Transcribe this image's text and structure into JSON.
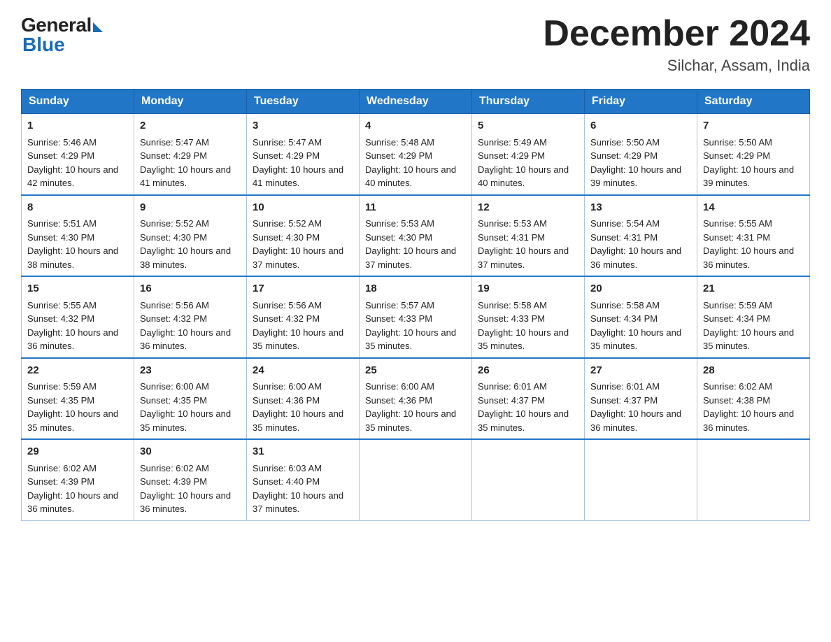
{
  "header": {
    "logo_general": "General",
    "logo_blue": "Blue",
    "title": "December 2024",
    "location": "Silchar, Assam, India"
  },
  "weekdays": [
    "Sunday",
    "Monday",
    "Tuesday",
    "Wednesday",
    "Thursday",
    "Friday",
    "Saturday"
  ],
  "weeks": [
    [
      {
        "day": "1",
        "sunrise": "5:46 AM",
        "sunset": "4:29 PM",
        "daylight": "10 hours and 42 minutes."
      },
      {
        "day": "2",
        "sunrise": "5:47 AM",
        "sunset": "4:29 PM",
        "daylight": "10 hours and 41 minutes."
      },
      {
        "day": "3",
        "sunrise": "5:47 AM",
        "sunset": "4:29 PM",
        "daylight": "10 hours and 41 minutes."
      },
      {
        "day": "4",
        "sunrise": "5:48 AM",
        "sunset": "4:29 PM",
        "daylight": "10 hours and 40 minutes."
      },
      {
        "day": "5",
        "sunrise": "5:49 AM",
        "sunset": "4:29 PM",
        "daylight": "10 hours and 40 minutes."
      },
      {
        "day": "6",
        "sunrise": "5:50 AM",
        "sunset": "4:29 PM",
        "daylight": "10 hours and 39 minutes."
      },
      {
        "day": "7",
        "sunrise": "5:50 AM",
        "sunset": "4:29 PM",
        "daylight": "10 hours and 39 minutes."
      }
    ],
    [
      {
        "day": "8",
        "sunrise": "5:51 AM",
        "sunset": "4:30 PM",
        "daylight": "10 hours and 38 minutes."
      },
      {
        "day": "9",
        "sunrise": "5:52 AM",
        "sunset": "4:30 PM",
        "daylight": "10 hours and 38 minutes."
      },
      {
        "day": "10",
        "sunrise": "5:52 AM",
        "sunset": "4:30 PM",
        "daylight": "10 hours and 37 minutes."
      },
      {
        "day": "11",
        "sunrise": "5:53 AM",
        "sunset": "4:30 PM",
        "daylight": "10 hours and 37 minutes."
      },
      {
        "day": "12",
        "sunrise": "5:53 AM",
        "sunset": "4:31 PM",
        "daylight": "10 hours and 37 minutes."
      },
      {
        "day": "13",
        "sunrise": "5:54 AM",
        "sunset": "4:31 PM",
        "daylight": "10 hours and 36 minutes."
      },
      {
        "day": "14",
        "sunrise": "5:55 AM",
        "sunset": "4:31 PM",
        "daylight": "10 hours and 36 minutes."
      }
    ],
    [
      {
        "day": "15",
        "sunrise": "5:55 AM",
        "sunset": "4:32 PM",
        "daylight": "10 hours and 36 minutes."
      },
      {
        "day": "16",
        "sunrise": "5:56 AM",
        "sunset": "4:32 PM",
        "daylight": "10 hours and 36 minutes."
      },
      {
        "day": "17",
        "sunrise": "5:56 AM",
        "sunset": "4:32 PM",
        "daylight": "10 hours and 35 minutes."
      },
      {
        "day": "18",
        "sunrise": "5:57 AM",
        "sunset": "4:33 PM",
        "daylight": "10 hours and 35 minutes."
      },
      {
        "day": "19",
        "sunrise": "5:58 AM",
        "sunset": "4:33 PM",
        "daylight": "10 hours and 35 minutes."
      },
      {
        "day": "20",
        "sunrise": "5:58 AM",
        "sunset": "4:34 PM",
        "daylight": "10 hours and 35 minutes."
      },
      {
        "day": "21",
        "sunrise": "5:59 AM",
        "sunset": "4:34 PM",
        "daylight": "10 hours and 35 minutes."
      }
    ],
    [
      {
        "day": "22",
        "sunrise": "5:59 AM",
        "sunset": "4:35 PM",
        "daylight": "10 hours and 35 minutes."
      },
      {
        "day": "23",
        "sunrise": "6:00 AM",
        "sunset": "4:35 PM",
        "daylight": "10 hours and 35 minutes."
      },
      {
        "day": "24",
        "sunrise": "6:00 AM",
        "sunset": "4:36 PM",
        "daylight": "10 hours and 35 minutes."
      },
      {
        "day": "25",
        "sunrise": "6:00 AM",
        "sunset": "4:36 PM",
        "daylight": "10 hours and 35 minutes."
      },
      {
        "day": "26",
        "sunrise": "6:01 AM",
        "sunset": "4:37 PM",
        "daylight": "10 hours and 35 minutes."
      },
      {
        "day": "27",
        "sunrise": "6:01 AM",
        "sunset": "4:37 PM",
        "daylight": "10 hours and 36 minutes."
      },
      {
        "day": "28",
        "sunrise": "6:02 AM",
        "sunset": "4:38 PM",
        "daylight": "10 hours and 36 minutes."
      }
    ],
    [
      {
        "day": "29",
        "sunrise": "6:02 AM",
        "sunset": "4:39 PM",
        "daylight": "10 hours and 36 minutes."
      },
      {
        "day": "30",
        "sunrise": "6:02 AM",
        "sunset": "4:39 PM",
        "daylight": "10 hours and 36 minutes."
      },
      {
        "day": "31",
        "sunrise": "6:03 AM",
        "sunset": "4:40 PM",
        "daylight": "10 hours and 37 minutes."
      },
      null,
      null,
      null,
      null
    ]
  ],
  "labels": {
    "sunrise": "Sunrise:",
    "sunset": "Sunset:",
    "daylight": "Daylight:"
  }
}
